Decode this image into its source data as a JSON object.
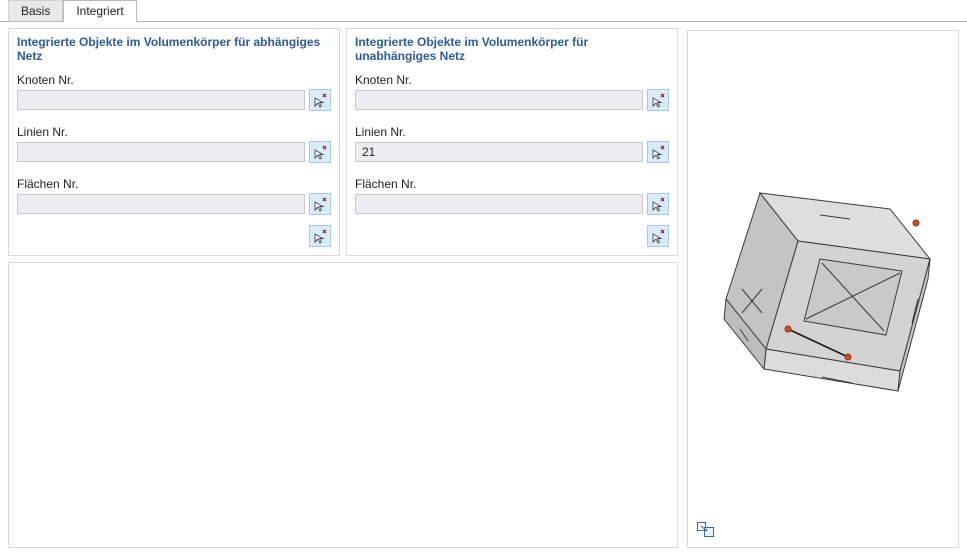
{
  "tabs": {
    "basis": "Basis",
    "integriert": "Integriert",
    "active": "integriert"
  },
  "panel_dependent": {
    "title": "Integrierte Objekte im Volumenkörper für abhängiges Netz",
    "knoten_label": "Knoten Nr.",
    "knoten_value": "",
    "linien_label": "Linien Nr.",
    "linien_value": "",
    "flaechen_label": "Flächen Nr.",
    "flaechen_value": ""
  },
  "panel_independent": {
    "title": "Integrierte Objekte im Volumenkörper für unabhängiges Netz",
    "knoten_label": "Knoten Nr.",
    "knoten_value": "",
    "linien_label": "Linien Nr.",
    "linien_value": "21",
    "flaechen_label": "Flächen Nr.",
    "flaechen_value": ""
  },
  "icons": {
    "pick": "pick-cursor-icon",
    "preview_toggle": "preview-toggle-icon"
  },
  "colors": {
    "panel_border": "#d9d9d9",
    "title_text": "#2a5ca8",
    "input_bg": "#ececf2",
    "button_bg": "#d8ecff",
    "solid_fill": "#d3d3d3",
    "solid_fill_light": "#e8e8e8",
    "solid_fill_dark": "#c4c4c4",
    "solid_stroke": "#3a3a3a",
    "node_fill": "#d04a1c"
  }
}
